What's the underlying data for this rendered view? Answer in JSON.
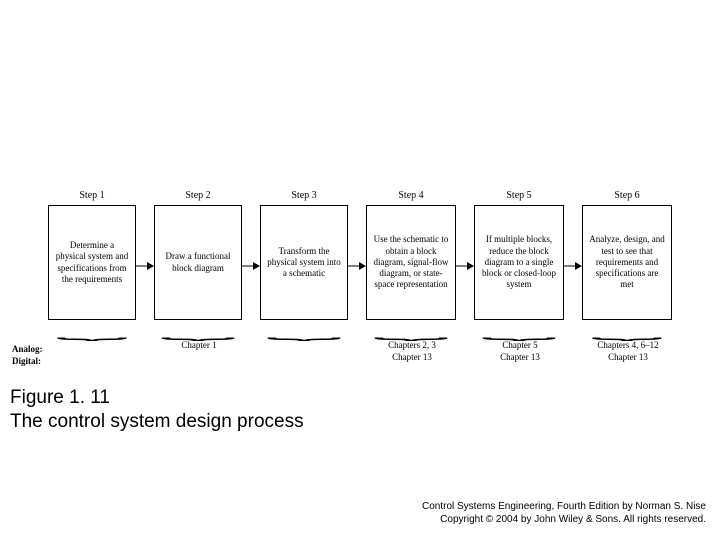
{
  "side": {
    "a": "Analog:",
    "d": "Digital:"
  },
  "steps": [
    {
      "step": "Step 1",
      "text": "Determine a physical system and specifications from the requirements",
      "a": "",
      "d": ""
    },
    {
      "step": "Step 2",
      "text": "Draw a functional block diagram",
      "a": "Chapter 1",
      "d": ""
    },
    {
      "step": "Step 3",
      "text": "Transform the physical system into a schematic",
      "a": "",
      "d": ""
    },
    {
      "step": "Step 4",
      "text": "Use the schematic to obtain a block diagram, signal-flow diagram, or state-space representation",
      "a": "Chapters 2, 3",
      "d": "Chapter 13"
    },
    {
      "step": "Step 5",
      "text": "If multiple blocks, reduce the block diagram to a single block or closed-loop system",
      "a": "Chapter 5",
      "d": "Chapter 13"
    },
    {
      "step": "Step 6",
      "text": "Analyze, design, and test to see that requirements and specifications are met",
      "a": "Chapters 4, 6–12",
      "d": "Chapter 13"
    }
  ],
  "caption": {
    "fig": "Figure 1. 11",
    "title": "The control system design process"
  },
  "credit": {
    "l1": "Control Systems Engineering, Fourth Edition by Norman S. Nise",
    "l2": "Copyright © 2004 by John Wiley & Sons. All rights reserved."
  }
}
